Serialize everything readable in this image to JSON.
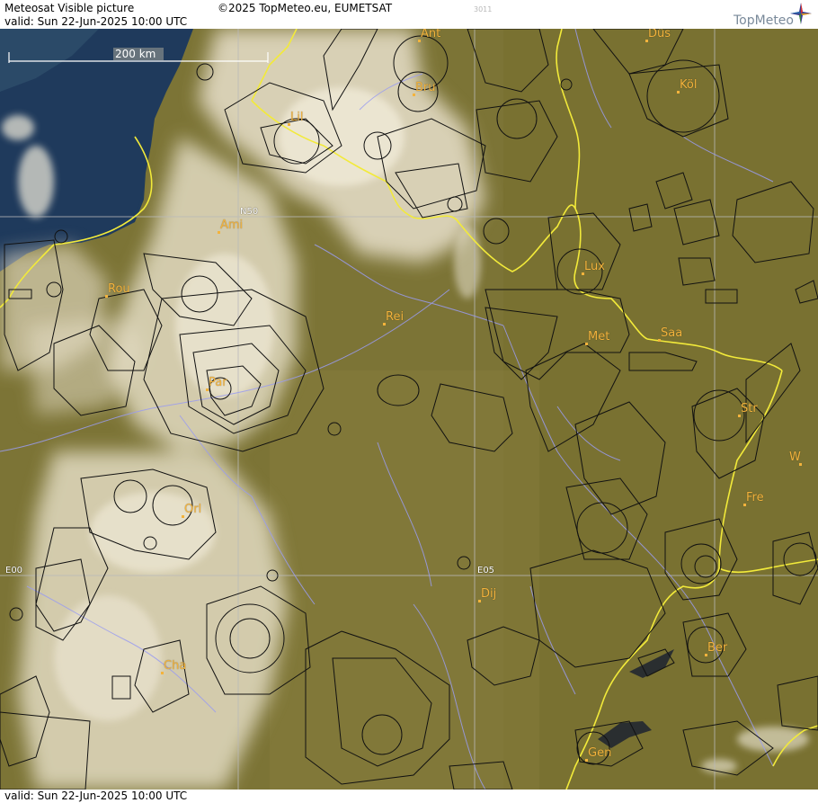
{
  "header": {
    "title": "Meteosat Visible picture",
    "valid": "valid:  Sun  22-Jun-2025  10:00 UTC",
    "copyright": "©2025 TopMeteo.eu, EUMETSAT",
    "code": "3011",
    "logo_text": "TopMeteo",
    "logo_icon": "compass-star-icon"
  },
  "footer": {
    "valid": "valid:  Sun  22-Jun-2025  10:00 UTC"
  },
  "map": {
    "scale_bar_label": "200 km",
    "grid_labels": {
      "lat50": "N50",
      "lon0": "E00",
      "lon5": "E05"
    },
    "cities": [
      {
        "name": "Ant"
      },
      {
        "name": "Düs"
      },
      {
        "name": "Bru"
      },
      {
        "name": "Köl"
      },
      {
        "name": "Lil"
      },
      {
        "name": "Ami"
      },
      {
        "name": "Lux"
      },
      {
        "name": "Rou"
      },
      {
        "name": "Rei"
      },
      {
        "name": "Saa"
      },
      {
        "name": "Met"
      },
      {
        "name": "Par"
      },
      {
        "name": "Str"
      },
      {
        "name": "W"
      },
      {
        "name": "Fre"
      },
      {
        "name": "Orl"
      },
      {
        "name": "Dij"
      },
      {
        "name": "Ber"
      },
      {
        "name": "Cha"
      },
      {
        "name": "Gen"
      }
    ],
    "colors": {
      "city_label": "#f3b33c",
      "border": "#f2ea3a",
      "river": "#9a9cf0",
      "airspace": "#111111",
      "grid": "#b9b9b9",
      "sea": "#1f3a5c",
      "land": "#7c7436",
      "cloud": "#e9e1cb"
    }
  }
}
